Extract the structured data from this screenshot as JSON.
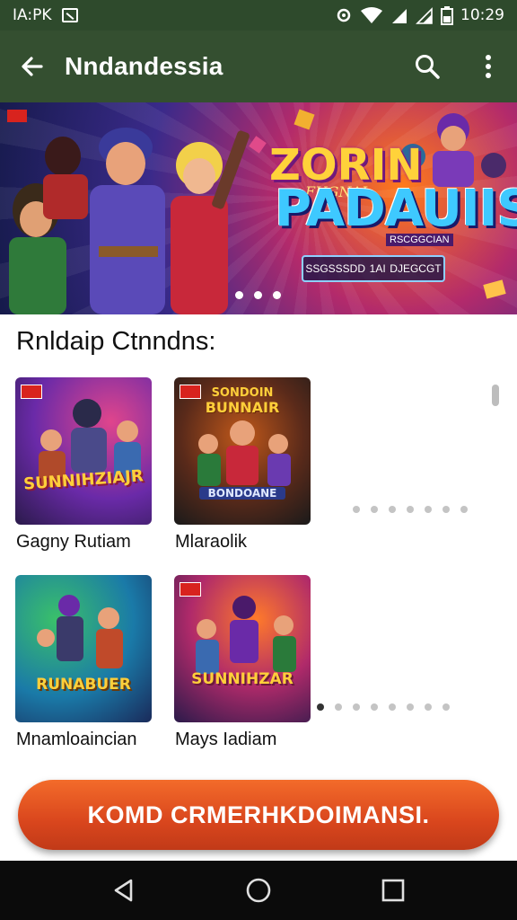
{
  "status_bar": {
    "carrier": "IA:PK",
    "time": "10:29"
  },
  "app_bar": {
    "title": "Nndandessia"
  },
  "banner": {
    "title_line1": "ZORIN",
    "title_line2": "FUGNAL",
    "title_line3": "PADAUIIS",
    "tagline": "RSCGGCIAN",
    "pill_left": "SSGSSSDD",
    "pill_mid": "1AI",
    "pill_right": "DJEGCGT",
    "page_count": 3
  },
  "section": {
    "title": "Rnldaip Ctnndns:",
    "cards": [
      {
        "label": "Gagny Rutiam",
        "art_text": "SUNNIHZIAJR",
        "art_colors": [
          "#6a2aa8",
          "#e0458c",
          "#ff9a2a"
        ]
      },
      {
        "label": "Mlaraolik",
        "art_text": "BUNNAIR",
        "art_top_text": "SONDOIN",
        "art_sub_text": "BONDOANE",
        "art_colors": [
          "#3a2a1a",
          "#c0581a",
          "#2a6a3a"
        ]
      },
      {
        "label": "Mnamloaincian",
        "art_text": "RUNABUER",
        "art_colors": [
          "#1a7aa8",
          "#3ac06a",
          "#ffb43a"
        ]
      },
      {
        "label": "Mays Iadiam",
        "art_text": "SUNNIHZAR",
        "art_colors": [
          "#4a1a6a",
          "#b02a6a",
          "#ff7a2a"
        ]
      }
    ],
    "row1_dots": 7,
    "row2_dots": 8
  },
  "cta": {
    "label": "KOMD CRMERHKDOIMANSI."
  },
  "colors": {
    "status_bar": "#2e4a2c",
    "app_bar": "#344f30",
    "cta": "#e0521f",
    "nav_bar": "#0b0b0b"
  },
  "icons": [
    "back-arrow-icon",
    "search-icon",
    "more-vert-icon",
    "wifi-icon",
    "signal-icon",
    "battery-icon",
    "nav-back-icon",
    "nav-home-icon",
    "nav-recents-icon"
  ]
}
